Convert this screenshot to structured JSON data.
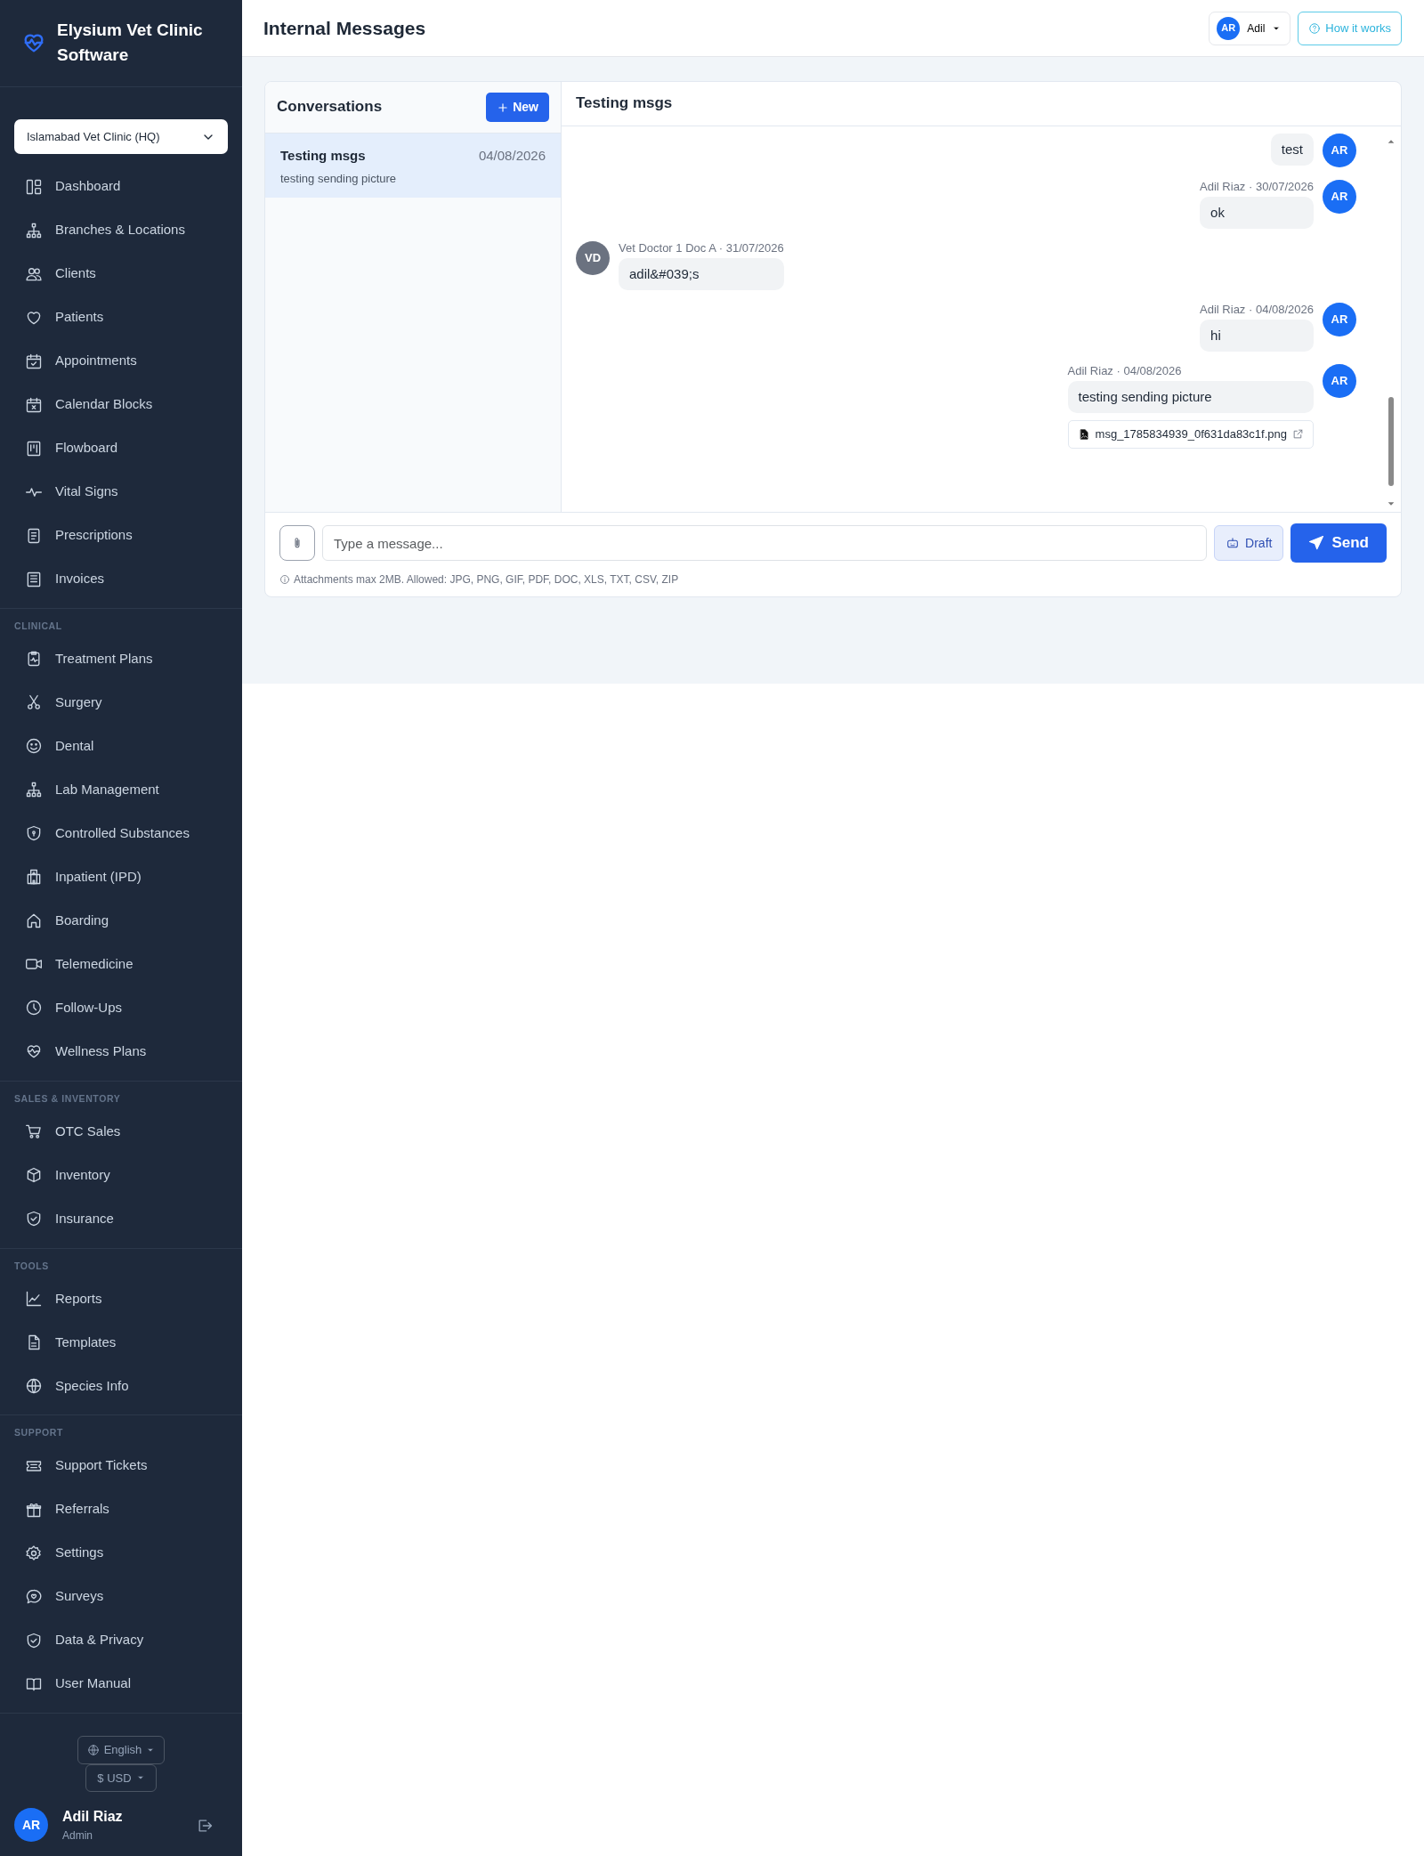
{
  "sidebar": {
    "brand": "Elysium Vet Clinic Software",
    "branch_select": {
      "value": "Islamabad Vet Clinic (HQ)"
    },
    "sections": [
      {
        "items": [
          {
            "label": "Dashboard",
            "selected": false
          },
          {
            "label": "Branches & Locations",
            "selected": false
          },
          {
            "label": "Clients",
            "selected": false
          },
          {
            "label": "Patients",
            "selected": false
          },
          {
            "label": "Appointments",
            "selected": false
          },
          {
            "label": "Calendar Blocks",
            "selected": false
          },
          {
            "label": "Flowboard",
            "selected": false
          },
          {
            "label": "Vital Signs",
            "selected": false
          },
          {
            "label": "Prescriptions",
            "selected": false
          },
          {
            "label": "Invoices",
            "selected": false
          }
        ]
      },
      {
        "heading": "CLINICAL",
        "items": [
          {
            "label": "Treatment Plans",
            "selected": false
          },
          {
            "label": "Surgery",
            "selected": false
          },
          {
            "label": "Dental",
            "selected": false
          },
          {
            "label": "Lab Management",
            "selected": false
          },
          {
            "label": "Controlled Substances",
            "selected": false
          },
          {
            "label": "Inpatient (IPD)",
            "selected": false
          },
          {
            "label": "Boarding",
            "selected": false
          },
          {
            "label": "Telemedicine",
            "selected": false
          },
          {
            "label": "Follow-Ups",
            "selected": false
          },
          {
            "label": "Wellness Plans",
            "selected": false
          }
        ]
      },
      {
        "heading": "SALES & INVENTORY",
        "items": [
          {
            "label": "OTC Sales",
            "selected": false
          },
          {
            "label": "Inventory",
            "selected": false
          },
          {
            "label": "Insurance",
            "selected": false
          }
        ]
      },
      {
        "heading": "TOOLS",
        "items": [
          {
            "label": "Reports",
            "selected": false
          },
          {
            "label": "Templates",
            "selected": false
          },
          {
            "label": "Species Info",
            "selected": false
          }
        ]
      },
      {
        "heading": "SUPPORT",
        "items": [
          {
            "label": "Support Tickets",
            "selected": false
          },
          {
            "label": "Referrals",
            "selected": false
          },
          {
            "label": "Settings",
            "selected": false
          },
          {
            "label": "Surveys",
            "selected": false
          },
          {
            "label": "Data & Privacy",
            "selected": false
          },
          {
            "label": "User Manual",
            "selected": false
          }
        ]
      }
    ],
    "language_button": "English",
    "currency_button": "$ USD",
    "user": {
      "initials": "AR",
      "name": "Adil Riaz",
      "role": "Admin"
    }
  },
  "header": {
    "title": "Internal Messages",
    "user_menu": {
      "initials": "AR",
      "name": "Adil"
    },
    "help_button": "How it works"
  },
  "conversations": {
    "title": "Conversations",
    "new_button": "New",
    "items": [
      {
        "title": "Testing msgs",
        "date": "04/08/2026",
        "preview": "testing sending picture",
        "selected": true
      }
    ]
  },
  "chat": {
    "title": "Testing msgs",
    "messages": [
      {
        "kind": "sent",
        "initials": "AR",
        "text": "test"
      },
      {
        "kind": "sent",
        "initials": "AR",
        "meta": "Adil Riaz · 30/07/2026",
        "text": "ok"
      },
      {
        "kind": "received",
        "initials": "VD",
        "meta": "Vet Doctor 1 Doc A · 31/07/2026",
        "text": "adil&#039;s"
      },
      {
        "kind": "sent",
        "initials": "AR",
        "meta": "Adil Riaz · 04/08/2026",
        "text": "hi"
      },
      {
        "kind": "sent",
        "initials": "AR",
        "meta": "Adil Riaz · 04/08/2026",
        "text": "testing sending picture",
        "attachment": "msg_1785834939_0f631da83c1f.png"
      }
    ],
    "input": {
      "placeholder": "Type a message..."
    },
    "draft_button": "Draft",
    "send_button": "Send",
    "note": "Attachments max 2MB. Allowed: JPG, PNG, GIF, PDF, DOC, XLS, TXT, CSV, ZIP"
  }
}
